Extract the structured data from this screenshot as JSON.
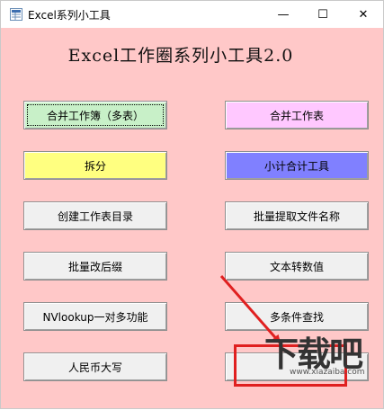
{
  "window": {
    "title": "Excel系列小工具",
    "minimize_glyph": "—",
    "maximize_glyph": "☐",
    "close_glyph": "✕"
  },
  "main": {
    "heading": "Excel工作圈系列小工具2.0",
    "background_color": "#ffc8c8"
  },
  "buttons": {
    "merge_workbooks": "合并工作簿（多表）",
    "merge_sheets": "合并工作表",
    "split": "拆分",
    "subtotal_tool": "小计合计工具",
    "create_sheet_index": "创建工作表目录",
    "batch_extract_filenames": "批量提取文件名称",
    "batch_change_extension": "批量改后缀",
    "text_to_number": "文本转数值",
    "vlookup_one_to_many": "NVlookup一对多功能",
    "multi_condition_lookup": "多条件查找",
    "rmb_uppercase": "人民币大写",
    "blank": ""
  },
  "button_colors": {
    "merge_workbooks": "#c8f0c8",
    "merge_sheets": "#ffc8ff",
    "split": "#ffff80",
    "subtotal_tool": "#8080ff",
    "default": "#f0f0f0"
  },
  "annotation": {
    "color": "#e02020"
  },
  "watermark": {
    "main_text": "下载吧",
    "sub_text": "www.xiazaiba.com"
  }
}
